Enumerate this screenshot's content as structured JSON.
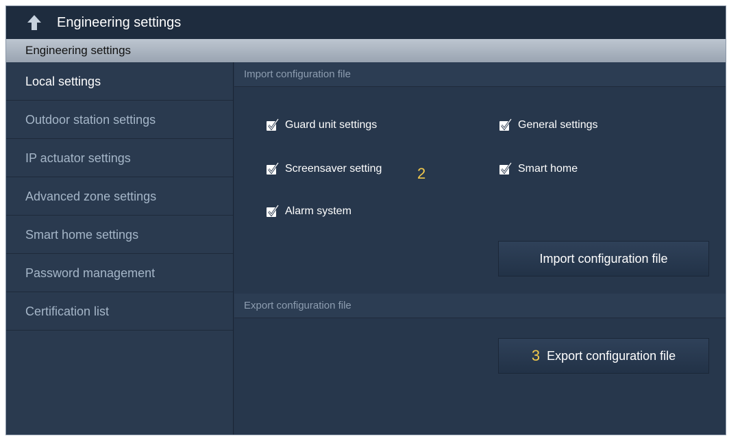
{
  "window": {
    "title": "Engineering settings"
  },
  "section_header": "Engineering settings",
  "sidebar": {
    "items": [
      {
        "label": "Local settings",
        "active": true
      },
      {
        "label": "Outdoor station settings"
      },
      {
        "label": "IP actuator settings"
      },
      {
        "label": "Advanced zone settings"
      },
      {
        "label": "Smart home settings"
      },
      {
        "label": "Password management"
      },
      {
        "label": "Certification list"
      }
    ]
  },
  "import": {
    "header": "Import configuration file",
    "checks": [
      {
        "label": "Guard unit settings",
        "checked": true
      },
      {
        "label": "General settings",
        "checked": true
      },
      {
        "label": "Screensaver setting",
        "checked": true
      },
      {
        "label": "Smart home",
        "checked": true
      },
      {
        "label": "Alarm system",
        "checked": true
      }
    ],
    "annotation": "2",
    "button_label": "Import configuration file"
  },
  "export": {
    "header": "Export configuration file",
    "annotation": "3",
    "button_label": "Export configuration file"
  },
  "icons": {
    "back": "back-arrow-icon",
    "checkbox": "checkbox-checked-icon"
  },
  "colors": {
    "accent": "#f2c94c",
    "background": "#26354a",
    "header": "#bdc6d0"
  }
}
